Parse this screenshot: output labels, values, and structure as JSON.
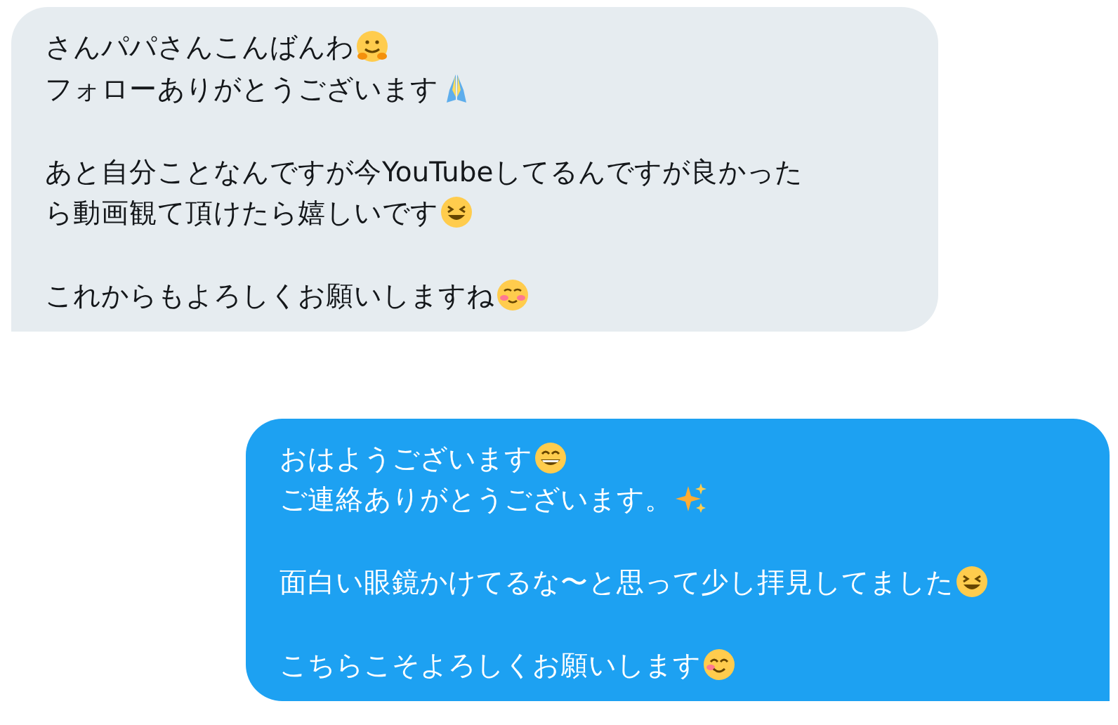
{
  "messages": [
    {
      "kind": "received",
      "paragraphs": [
        [
          {
            "text": "さんパパさんこんばんわ",
            "kind": "hugging"
          },
          {
            "text": "フォローありがとうございます",
            "kind": "pray"
          }
        ],
        [
          {
            "text": "あと自分ことなんですが今YouTubeしてるんですが良かった",
            "kind": "plain"
          },
          {
            "text": "ら動画観て頂けたら嬉しいです",
            "kind": "laugh"
          }
        ],
        [
          {
            "text": "これからもよろしくお願いしますね",
            "kind": "blush"
          }
        ]
      ]
    },
    {
      "kind": "sent",
      "paragraphs": [
        [
          {
            "text": "おはようございます",
            "kind": "grin"
          },
          {
            "text": "ご連絡ありがとうございます。",
            "kind": "sparkles"
          }
        ],
        [
          {
            "text": "面白い眼鏡かけてるな〜と思って少し拝見してました",
            "kind": "laugh"
          }
        ],
        [
          {
            "text": "こちらこそよろしくお願いします",
            "kind": "smile"
          }
        ]
      ]
    }
  ]
}
